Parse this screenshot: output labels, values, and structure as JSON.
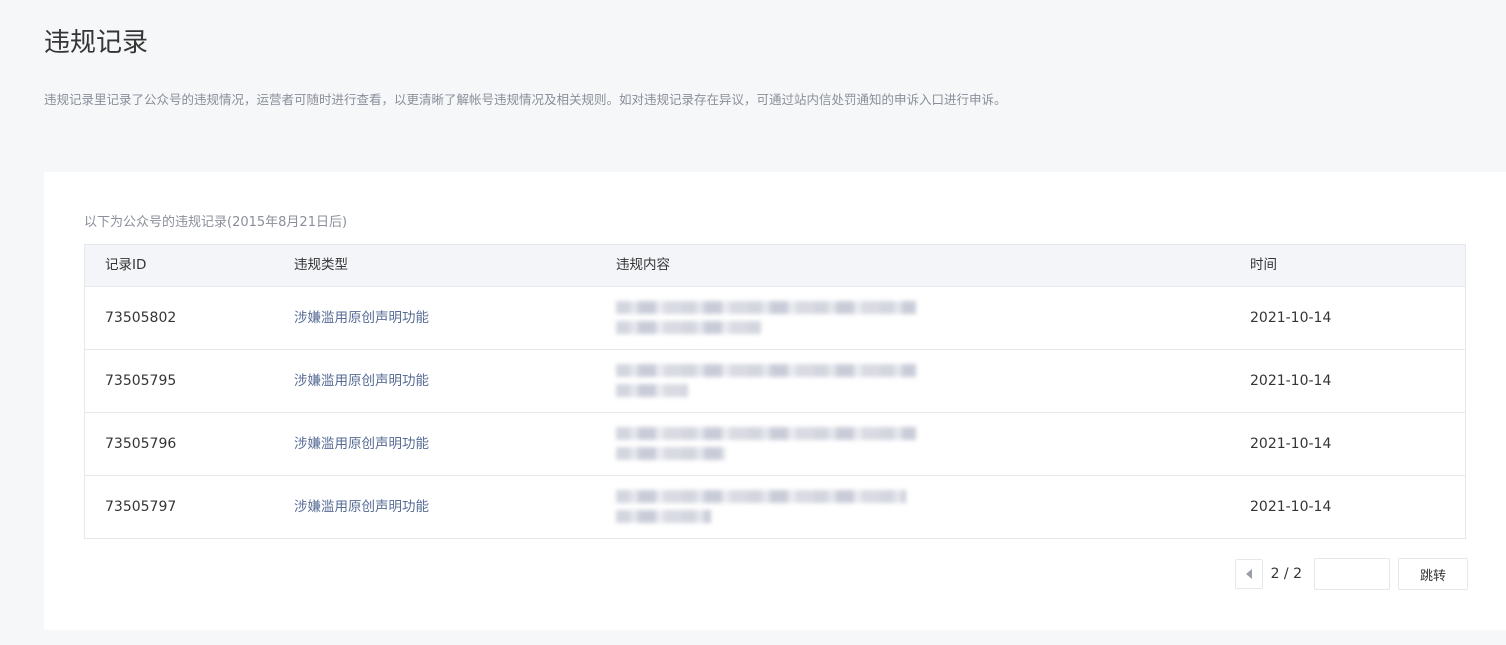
{
  "page": {
    "title": "违规记录",
    "description": "违规记录里记录了公众号的违规情况，运营者可随时进行查看，以更清晰了解帐号违规情况及相关规则。如对违规记录存在异议，可通过站内信处罚通知的申诉入口进行申诉。"
  },
  "records": {
    "caption": "以下为公众号的违规记录(2015年8月21日后)",
    "columns": {
      "id": "记录ID",
      "type": "违规类型",
      "content": "违规内容",
      "time": "时间"
    },
    "rows": [
      {
        "id": "73505802",
        "type": "涉嫌滥用原创声明功能",
        "time": "2021-10-14"
      },
      {
        "id": "73505795",
        "type": "涉嫌滥用原创声明功能",
        "time": "2021-10-14"
      },
      {
        "id": "73505796",
        "type": "涉嫌滥用原创声明功能",
        "time": "2021-10-14"
      },
      {
        "id": "73505797",
        "type": "涉嫌滥用原创声明功能",
        "time": "2021-10-14"
      }
    ]
  },
  "pagination": {
    "page_indicator": "2 / 2",
    "jump_input_value": "",
    "jump_label": "跳转"
  }
}
